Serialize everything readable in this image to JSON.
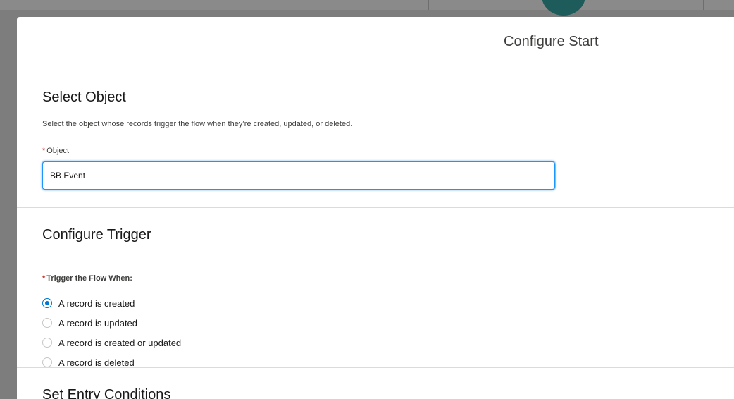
{
  "modal": {
    "title": "Configure Start"
  },
  "select_object": {
    "title": "Select Object",
    "description": "Select the object whose records trigger the flow when they’re created, updated, or deleted.",
    "required_marker": "*",
    "field_label": "Object",
    "field_value": "BB Event"
  },
  "configure_trigger": {
    "title": "Configure Trigger",
    "required_marker": "*",
    "field_label": "Trigger the Flow When:",
    "options": [
      {
        "label": "A record is created",
        "checked": true
      },
      {
        "label": "A record is updated",
        "checked": false
      },
      {
        "label": "A record is created or updated",
        "checked": false
      },
      {
        "label": "A record is deleted",
        "checked": false
      }
    ]
  },
  "entry_conditions": {
    "title": "Set Entry Conditions"
  },
  "colors": {
    "accent": "#0176d3",
    "required": "#c23934",
    "backdrop": "#7d7d7d"
  }
}
